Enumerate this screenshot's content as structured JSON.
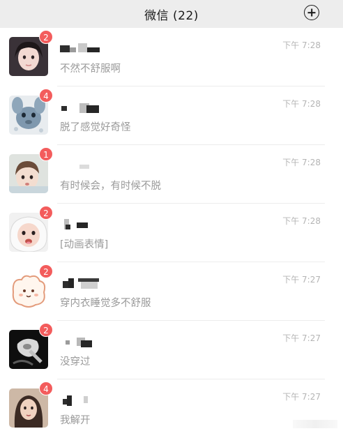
{
  "header": {
    "title": "微信 (22)",
    "add_icon": "plus-circle-icon"
  },
  "chats": [
    {
      "badge": "2",
      "time": "下午 7:28",
      "preview": "不然不舒服啊"
    },
    {
      "badge": "4",
      "time": "下午 7:28",
      "preview": "脱了感觉好奇怪"
    },
    {
      "badge": "1",
      "time": "下午 7:28",
      "preview": "有时候会，有时候不脱"
    },
    {
      "badge": "2",
      "time": "下午 7:28",
      "preview": "[动画表情]"
    },
    {
      "badge": "2",
      "time": "下午 7:27",
      "preview": "穿内衣睡觉多不舒服"
    },
    {
      "badge": "2",
      "time": "下午 7:27",
      "preview": "没穿过"
    },
    {
      "badge": "4",
      "time": "下午 7:27",
      "preview": "我解开"
    }
  ],
  "colors": {
    "badge": "#f35c5c",
    "header_bg": "#ededed",
    "time": "#b4b4b4",
    "preview": "#9a9a9a"
  }
}
